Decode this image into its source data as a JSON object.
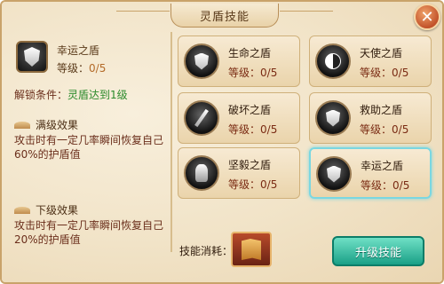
{
  "window": {
    "title": "灵盾技能"
  },
  "selected_skill": {
    "name": "幸运之盾",
    "level_label": "等级：",
    "level_value": "0/5",
    "unlock_label": "解锁条件：",
    "unlock_value": "灵盾达到1级"
  },
  "sections": {
    "max_title": "满级效果",
    "max_desc": "攻击时有一定几率瞬间恢复自己60%的护盾值",
    "next_title": "下级效果",
    "next_desc": "攻击时有一定几率瞬间恢复自己20%的护盾值"
  },
  "skills": [
    {
      "name": "生命之盾",
      "level_label": "等级：",
      "level_value": "0/5",
      "icon": "shield-icon"
    },
    {
      "name": "天使之盾",
      "level_label": "等级：",
      "level_value": "0/5",
      "icon": "yin-yang-icon"
    },
    {
      "name": "破坏之盾",
      "level_label": "等级：",
      "level_value": "0/5",
      "icon": "sword-icon"
    },
    {
      "name": "救助之盾",
      "level_label": "等级：",
      "level_value": "0/5",
      "icon": "shield-icon"
    },
    {
      "name": "坚毅之盾",
      "level_label": "等级：",
      "level_value": "0/5",
      "icon": "warrior-icon"
    },
    {
      "name": "幸运之盾",
      "level_label": "等级：",
      "level_value": "0/5",
      "icon": "shield-icon"
    }
  ],
  "footer": {
    "cost_label": "技能消耗：",
    "upgrade_button": "升级技能"
  },
  "colors": {
    "accent": "#1aa087",
    "selected_outline": "#7ad7e1",
    "unlock_green": "#2b8a2b",
    "level_orange": "#b36a28"
  }
}
